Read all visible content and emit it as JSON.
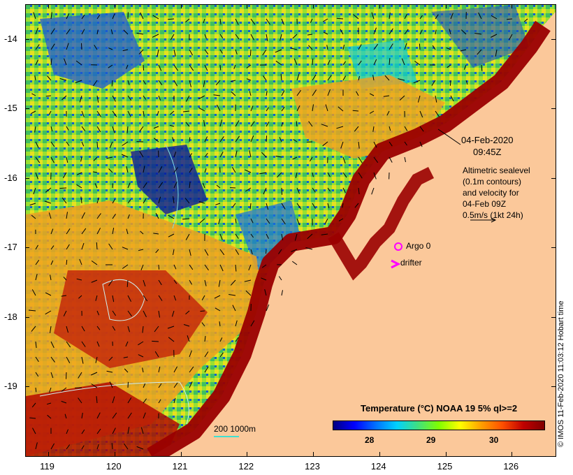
{
  "map": {
    "y_ticks": [
      "-14",
      "-15",
      "-16",
      "-17",
      "-18",
      "-19"
    ],
    "x_ticks": [
      "119",
      "120",
      "121",
      "122",
      "123",
      "124",
      "125",
      "126"
    ],
    "lat_range": [
      -19.99,
      -13.5
    ],
    "lon_range": [
      118.65,
      126.65
    ]
  },
  "annotations": {
    "date": "04-Feb-2020",
    "time": "09:45Z",
    "altimetry_lines": [
      "Altimetric sealevel",
      "(0.1m contours)",
      "and velocity for",
      "04-Feb 09Z",
      "0.5m/s (1kt 24h)"
    ],
    "argo_label": "Argo 0",
    "drifter_label": "drifter",
    "scale_label": "200  1000m"
  },
  "legend": {
    "title": "Temperature (°C) NOAA 19 5% ql>=2",
    "ticks": [
      "28",
      "29",
      "30"
    ],
    "range": [
      27.5,
      30.8
    ]
  },
  "copyright": "© IMOS 11-Feb-2020 11:03:12 Hobart time",
  "colors": {
    "land": "#fbc89a",
    "argo": "#ff00ff",
    "drifter": "#ff00ff"
  }
}
